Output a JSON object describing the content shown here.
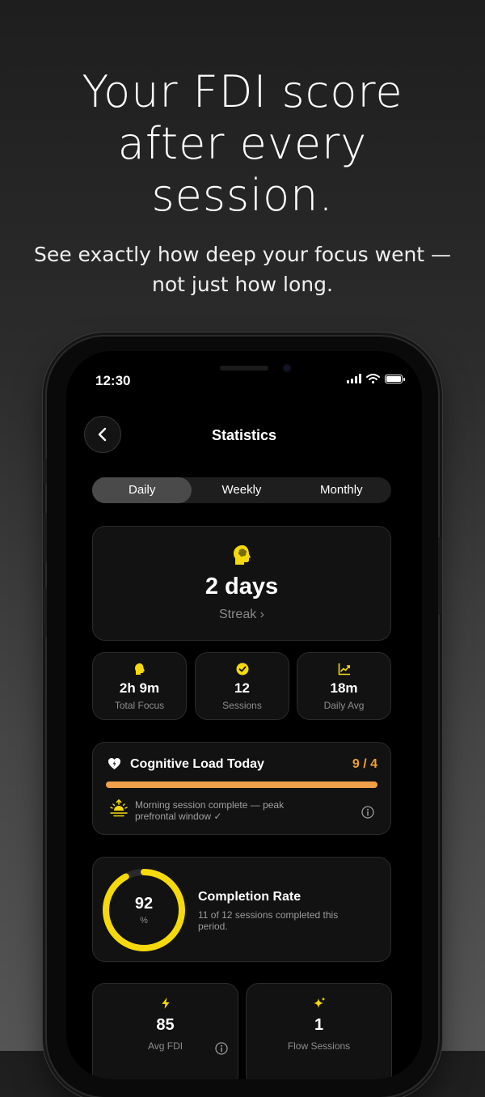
{
  "marketing": {
    "headline": "Your FDI score\nafter every\nsession.",
    "subheadline": "See exactly how deep your focus went — not just how long."
  },
  "status_bar": {
    "time": "12:30"
  },
  "nav": {
    "title": "Statistics"
  },
  "tabs": [
    {
      "label": "Daily",
      "active": true
    },
    {
      "label": "Weekly",
      "active": false
    },
    {
      "label": "Monthly",
      "active": false
    }
  ],
  "streak": {
    "value": "2 days",
    "label": "Streak ›"
  },
  "stats": [
    {
      "icon": "brain-icon",
      "value": "2h 9m",
      "label": "Total Focus"
    },
    {
      "icon": "check-circle-icon",
      "value": "12",
      "label": "Sessions"
    },
    {
      "icon": "trend-chart-icon",
      "value": "18m",
      "label": "Daily Avg"
    }
  ],
  "cognitive_load": {
    "title": "Cognitive Load Today",
    "score": "9 / 4",
    "progress": 1.0,
    "note": "Morning session complete — peak prefrontal window ✓"
  },
  "completion": {
    "value": "92",
    "unit": "%",
    "progress": 0.92,
    "title": "Completion Rate",
    "description": "11 of 12 sessions completed this period."
  },
  "bottom_stats": [
    {
      "icon": "bolt-icon",
      "value": "85",
      "label": "Avg FDI"
    },
    {
      "icon": "sparkle-icon",
      "value": "1",
      "label": "Flow Sessions"
    }
  ],
  "colors": {
    "accent": "#F5D90A",
    "load": "#F0A048",
    "load_text": "#F0A030"
  }
}
